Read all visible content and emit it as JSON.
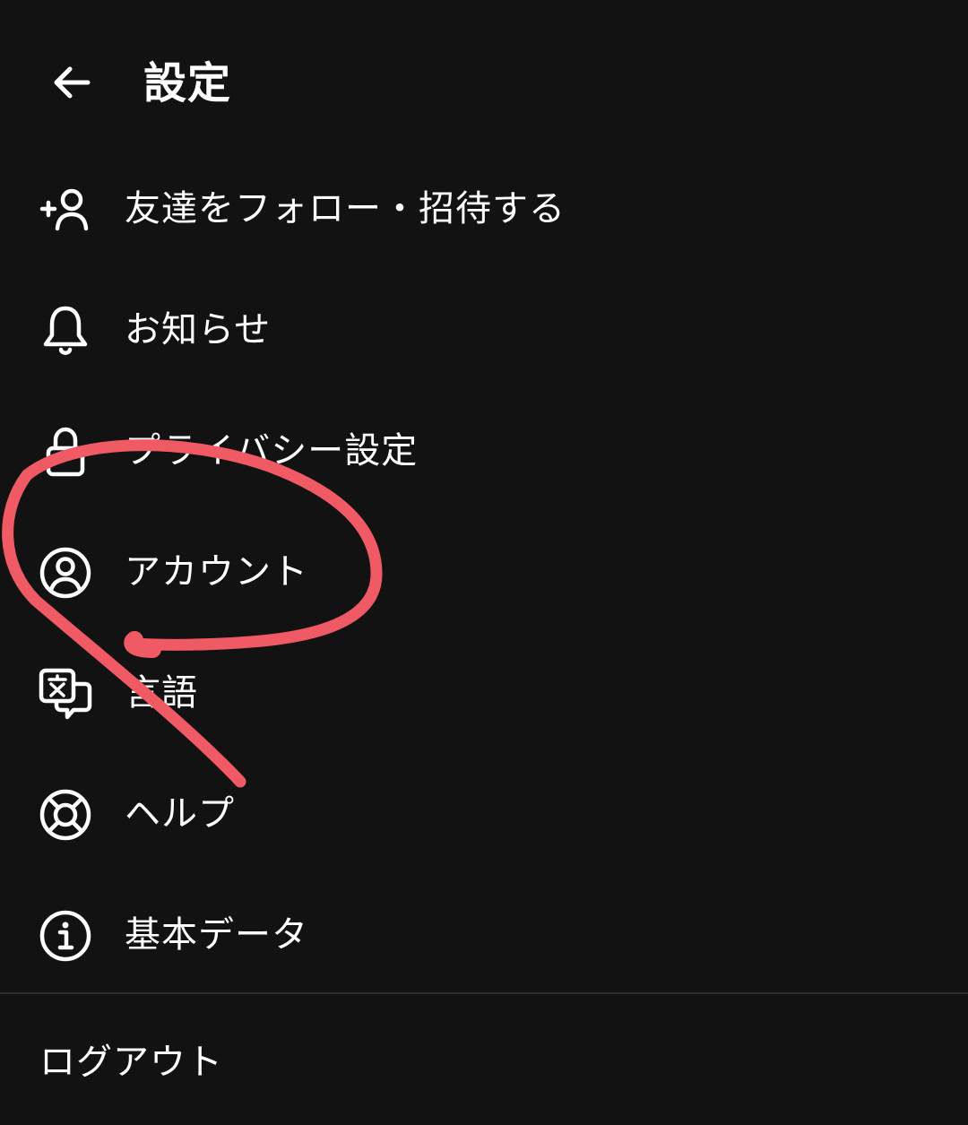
{
  "header": {
    "back_icon": "arrow-left-icon",
    "title": "設定"
  },
  "menu": {
    "items": [
      {
        "label": "友達をフォロー・招待する",
        "icon": "add-user-icon"
      },
      {
        "label": "お知らせ",
        "icon": "bell-icon"
      },
      {
        "label": "プライバシー設定",
        "icon": "lock-icon"
      },
      {
        "label": "アカウント",
        "icon": "account-circle-icon"
      },
      {
        "label": "言語",
        "icon": "translate-icon"
      },
      {
        "label": "ヘルプ",
        "icon": "lifebuoy-icon"
      },
      {
        "label": "基本データ",
        "icon": "info-icon"
      }
    ]
  },
  "footer": {
    "logout_label": "ログアウト"
  },
  "colors": {
    "background": "#121212",
    "text": "#ffffff",
    "annotation": "#f05a64",
    "divider": "#2c2c2c"
  }
}
